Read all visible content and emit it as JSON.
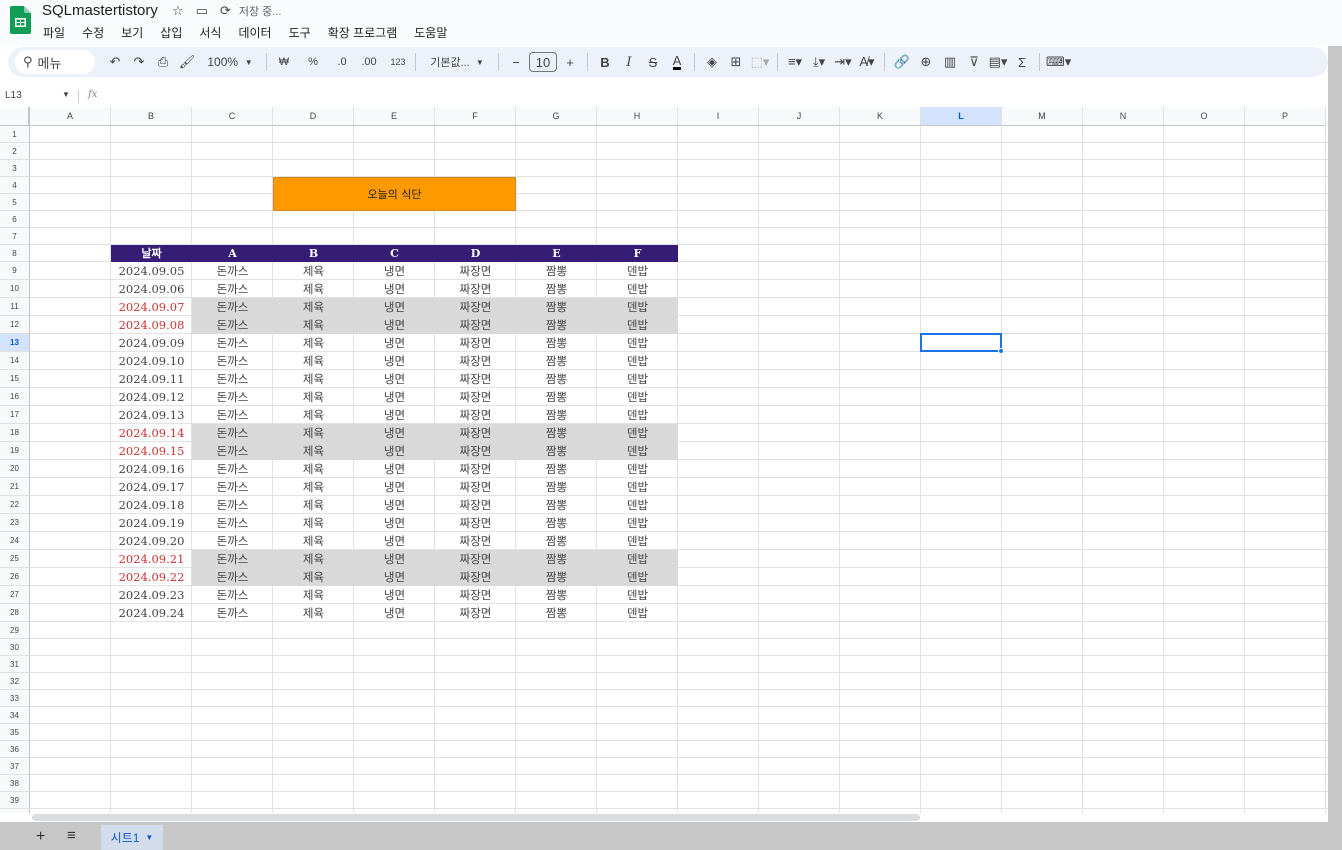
{
  "header": {
    "title": "SQLmastertistory",
    "saving_status": "저장 중...",
    "menus": [
      "파일",
      "수정",
      "보기",
      "삽입",
      "서식",
      "데이터",
      "도구",
      "확장 프로그램",
      "도움말"
    ]
  },
  "toolbar": {
    "search_label": "메뉴",
    "zoom": "100%",
    "currency": "₩",
    "percent": "%",
    "decimal_decrease": ".0",
    "decimal_increase": ".00",
    "format_123": "123",
    "font": "기본값...",
    "font_size": "10"
  },
  "formula_bar": {
    "name_box": "L13",
    "fx": "fx",
    "content": ""
  },
  "columns": [
    "A",
    "B",
    "C",
    "D",
    "E",
    "F",
    "G",
    "H",
    "I",
    "J",
    "K",
    "L",
    "M",
    "N",
    "O",
    "P"
  ],
  "selected_column": "L",
  "selected_row": 13,
  "sheet": {
    "banner": "오늘의 식단",
    "table_headers": [
      "날짜",
      "A",
      "B",
      "C",
      "D",
      "E",
      "F"
    ],
    "menu_items": [
      "돈까스",
      "제육",
      "냉면",
      "짜장면",
      "짬뽕",
      "덴밥"
    ],
    "rows": [
      {
        "date": "2024.09.05",
        "weekend": false
      },
      {
        "date": "2024.09.06",
        "weekend": false
      },
      {
        "date": "2024.09.07",
        "weekend": true
      },
      {
        "date": "2024.09.08",
        "weekend": true
      },
      {
        "date": "2024.09.09",
        "weekend": false
      },
      {
        "date": "2024.09.10",
        "weekend": false
      },
      {
        "date": "2024.09.11",
        "weekend": false
      },
      {
        "date": "2024.09.12",
        "weekend": false
      },
      {
        "date": "2024.09.13",
        "weekend": false
      },
      {
        "date": "2024.09.14",
        "weekend": true
      },
      {
        "date": "2024.09.15",
        "weekend": true
      },
      {
        "date": "2024.09.16",
        "weekend": false
      },
      {
        "date": "2024.09.17",
        "weekend": false
      },
      {
        "date": "2024.09.18",
        "weekend": false
      },
      {
        "date": "2024.09.19",
        "weekend": false
      },
      {
        "date": "2024.09.20",
        "weekend": false
      },
      {
        "date": "2024.09.21",
        "weekend": true
      },
      {
        "date": "2024.09.22",
        "weekend": true
      },
      {
        "date": "2024.09.23",
        "weekend": false
      },
      {
        "date": "2024.09.24",
        "weekend": false
      }
    ]
  },
  "sheet_tabs": {
    "add": "+",
    "list": "≡",
    "active": "시트1"
  },
  "colors": {
    "header_bg": "#351c75",
    "banner_bg": "#ff9900",
    "weekend_text": "#cc3333",
    "weekend_bg": "#d9d9d9",
    "selection": "#1a73e8"
  }
}
